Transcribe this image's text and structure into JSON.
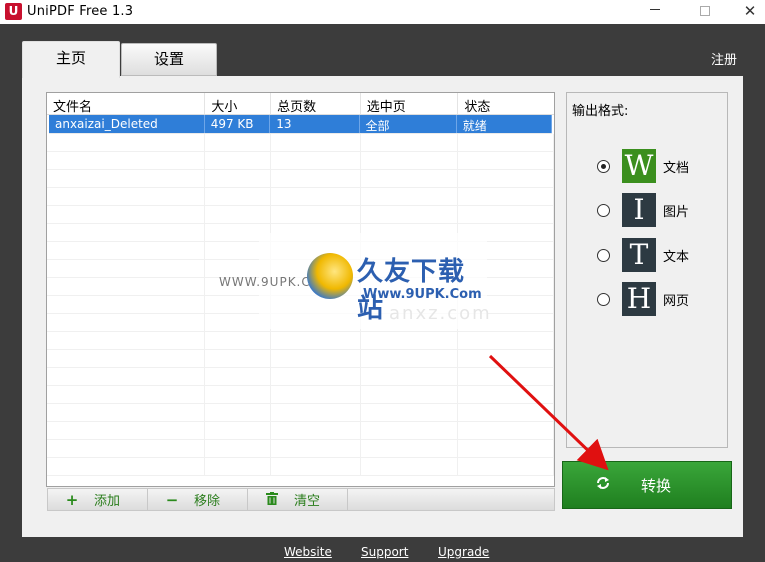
{
  "window": {
    "logo_text": "U",
    "title": "UniPDF Free 1.3",
    "minimize": "—",
    "close": "✕"
  },
  "tabs": [
    {
      "label": "主页",
      "active": true
    },
    {
      "label": "设置",
      "active": false
    }
  ],
  "register_label": "注册",
  "file_list": {
    "columns": [
      "文件名",
      "大小",
      "总页数",
      "选中页",
      "状态"
    ],
    "rows": [
      {
        "name": "anxaizai_Deleted",
        "size": "497 KB",
        "pages": "13",
        "selected_pages": "全部",
        "status": "就绪"
      }
    ]
  },
  "watermark": {
    "main": "久友下载站",
    "url": "Www.9UPK.Com",
    "left_text": "WWW.9UPK.COM",
    "right_text": "anxz.com"
  },
  "toolbar": {
    "add": "添加",
    "remove": "移除",
    "clear": "清空"
  },
  "output_format": {
    "title": "输出格式:",
    "selected": "文档",
    "options": [
      {
        "letter": "W",
        "label": "文档",
        "color": "#3b8f1e"
      },
      {
        "letter": "I",
        "label": "图片",
        "color": "#2d3a42"
      },
      {
        "letter": "T",
        "label": "文本",
        "color": "#2d3a42"
      },
      {
        "letter": "H",
        "label": "网页",
        "color": "#2d3a42"
      }
    ]
  },
  "convert_label": "转换",
  "footer": {
    "website": "Website",
    "support": "Support",
    "upgrade": "Upgrade"
  },
  "colors": {
    "dark_bg": "#3c3c3c",
    "selection": "#2f7ed8",
    "convert_green": "#2a932a",
    "arrow_red": "#e01010"
  }
}
